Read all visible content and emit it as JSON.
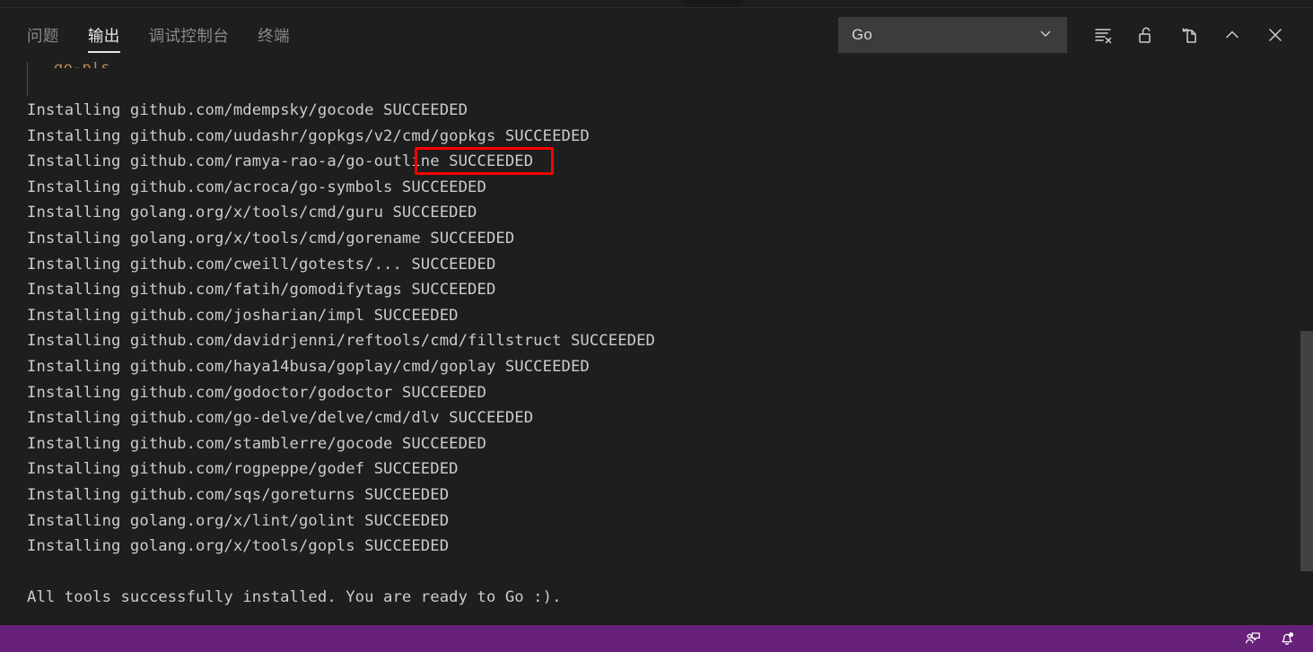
{
  "panel": {
    "tabs": [
      {
        "label": "问题",
        "name": "tab-problems",
        "active": false
      },
      {
        "label": "输出",
        "name": "tab-output",
        "active": true
      },
      {
        "label": "调试控制台",
        "name": "tab-debug-console",
        "active": false
      },
      {
        "label": "终端",
        "name": "tab-terminal",
        "active": false
      }
    ],
    "channel_select": {
      "value": "Go",
      "options": [
        "Go"
      ]
    },
    "actions": [
      {
        "name": "clear-output-button",
        "title": "清除输出"
      },
      {
        "name": "unlock-scroll-button",
        "title": "关闭自动滚动锁定"
      },
      {
        "name": "open-in-editor-button",
        "title": "在编辑器中打开输出"
      },
      {
        "name": "collapse-panel-button",
        "title": "折叠面板"
      },
      {
        "name": "close-panel-button",
        "title": "关闭面板"
      }
    ]
  },
  "output": {
    "clipped_top_line": "go-pls",
    "lines": [
      "Installing github.com/mdempsky/gocode SUCCEEDED",
      "Installing github.com/uudashr/gopkgs/v2/cmd/gopkgs SUCCEEDED",
      "Installing github.com/ramya-rao-a/go-outline SUCCEEDED",
      "Installing github.com/acroca/go-symbols SUCCEEDED",
      "Installing golang.org/x/tools/cmd/guru SUCCEEDED",
      "Installing golang.org/x/tools/cmd/gorename SUCCEEDED",
      "Installing github.com/cweill/gotests/... SUCCEEDED",
      "Installing github.com/fatih/gomodifytags SUCCEEDED",
      "Installing github.com/josharian/impl SUCCEEDED",
      "Installing github.com/davidrjenni/reftools/cmd/fillstruct SUCCEEDED",
      "Installing github.com/haya14busa/goplay/cmd/goplay SUCCEEDED",
      "Installing github.com/godoctor/godoctor SUCCEEDED",
      "Installing github.com/go-delve/delve/cmd/dlv SUCCEEDED",
      "Installing github.com/stamblerre/gocode SUCCEEDED",
      "Installing github.com/rogpeppe/godef SUCCEEDED",
      "Installing github.com/sqs/goreturns SUCCEEDED",
      "Installing golang.org/x/lint/golint SUCCEEDED",
      "Installing golang.org/x/tools/gopls SUCCEEDED",
      "",
      "All tools successfully installed. You are ready to Go :)."
    ]
  },
  "annotation": {
    "target_text": "SUCCEEDED",
    "color": "#ff0000"
  },
  "status_bar": {
    "background": "#68217a",
    "items": [
      {
        "name": "feedback-icon",
        "title": "推文反馈"
      },
      {
        "name": "notifications-bell-icon",
        "title": "通知"
      }
    ]
  },
  "colors": {
    "panel_background": "#1e1e1e",
    "text": "#cccccc",
    "tab_active_text": "#e7e7e7",
    "tab_inactive_text": "#8a8a8a",
    "select_background": "#3c3c3c",
    "scrollbar_thumb": "#424242",
    "annotation": "#ff0000",
    "status_bar": "#68217a"
  }
}
